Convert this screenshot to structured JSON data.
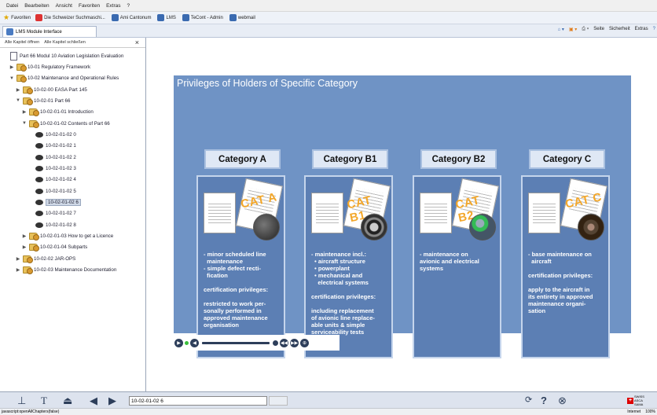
{
  "menu": [
    "Datei",
    "Bearbeiten",
    "Ansicht",
    "Favoriten",
    "Extras",
    "?"
  ],
  "favorites": {
    "label": "Favoriten",
    "items": [
      "Die Schweizer Suchmaschi...",
      "Ami Cantonum",
      "LMS",
      "TeCont - Admin",
      "webmail"
    ]
  },
  "tab": {
    "title": "LMS Module Interface"
  },
  "ie_tools": [
    "Seite",
    "Sicherheit",
    "Extras"
  ],
  "sidebar": {
    "expand_all": "Alle Kapitel öffnen",
    "collapse_all": "Alle Kapitel schließen",
    "tree": [
      {
        "label": "Part 66 Modul 10 Aviation Legislation Evaluation",
        "indent": 0,
        "icon": "doc",
        "arrow": ""
      },
      {
        "label": "10-01 Regulatory Framework",
        "indent": 1,
        "icon": "folder",
        "arrow": "▶"
      },
      {
        "label": "10-02 Maintenance and Operational Rules",
        "indent": 1,
        "icon": "folder",
        "arrow": "▼"
      },
      {
        "label": "10-02-00 EASA Part 145",
        "indent": 2,
        "icon": "folder",
        "arrow": "▶"
      },
      {
        "label": "10-02-01 Part 66",
        "indent": 2,
        "icon": "folder",
        "arrow": "▼"
      },
      {
        "label": "10-02-01-01 Introduction",
        "indent": 3,
        "icon": "folder",
        "arrow": "▶"
      },
      {
        "label": "10-02-01-02 Contents of Part 66",
        "indent": 3,
        "icon": "folder",
        "arrow": "▼"
      },
      {
        "label": "10-02-01-02 0",
        "indent": 4,
        "icon": "pie",
        "arrow": ""
      },
      {
        "label": "10-02-01-02 1",
        "indent": 4,
        "icon": "pie",
        "arrow": ""
      },
      {
        "label": "10-02-01-02 2",
        "indent": 4,
        "icon": "pie",
        "arrow": ""
      },
      {
        "label": "10-02-01-02 3",
        "indent": 4,
        "icon": "pie",
        "arrow": ""
      },
      {
        "label": "10-02-01-02 4",
        "indent": 4,
        "icon": "pie",
        "arrow": ""
      },
      {
        "label": "10-02-01-02 5",
        "indent": 4,
        "icon": "pie",
        "arrow": ""
      },
      {
        "label": "10-02-01-02 6",
        "indent": 4,
        "icon": "pie",
        "arrow": "",
        "selected": true
      },
      {
        "label": "10-02-01-02 7",
        "indent": 4,
        "icon": "pie",
        "arrow": ""
      },
      {
        "label": "10-02-01-02 8",
        "indent": 4,
        "icon": "pie",
        "arrow": ""
      },
      {
        "label": "10-02-01-03 How to get a Licence",
        "indent": 3,
        "icon": "folder",
        "arrow": "▶"
      },
      {
        "label": "10-02-01-04 Subparts",
        "indent": 3,
        "icon": "folder",
        "arrow": "▶"
      },
      {
        "label": "10-02-02 JAR-OPS",
        "indent": 2,
        "icon": "folder",
        "arrow": "▶"
      },
      {
        "label": "10-02-03 Maintenance Documentation",
        "indent": 2,
        "icon": "folder",
        "arrow": "▶"
      }
    ]
  },
  "slide": {
    "title": "Privileges of Holders of Specific Category",
    "cards": [
      {
        "name": "Category A",
        "stamp": "CAT A",
        "photo": "engine",
        "lines": [
          "- minor scheduled line",
          "  maintenance",
          "- simple defect recti-",
          "  fication",
          "",
          "certification privileges:",
          "",
          "restricted to work per-",
          "sonally performed in",
          "approved maintenance",
          "organisation"
        ]
      },
      {
        "name": "Category B1",
        "stamp": "CAT B1",
        "photo": "gear",
        "lines": [
          "- maintenance incl.:",
          "  • aircraft structure",
          "  • powerplant",
          "  • mechanical and",
          "    electrical systems",
          "",
          "certification privileges:",
          "",
          "including replacement",
          "of avionic line replace-",
          "able units & simple",
          "serviceability tests"
        ]
      },
      {
        "name": "Category B2",
        "stamp": "CAT B2",
        "photo": "person",
        "lines": [
          "- maintenance on",
          "avionic and electrical",
          "systems"
        ]
      },
      {
        "name": "Category C",
        "stamp": "CAT C",
        "photo": "wing",
        "lines": [
          "- base maintenance on",
          "  aircraft",
          "",
          "certification privileges:",
          "",
          "apply to the aircraft in",
          "its entirety in approved",
          "maintenance organi-",
          "sation"
        ]
      }
    ]
  },
  "bottom": {
    "page_field": "10-02-01-02 6"
  },
  "brand": {
    "line1": "SWISS",
    "line2": "ASCA",
    "line3": "SAMA"
  },
  "status": {
    "left": "javascript:openAllChapters(false)",
    "zone": "Internet",
    "zoom": "100%"
  }
}
